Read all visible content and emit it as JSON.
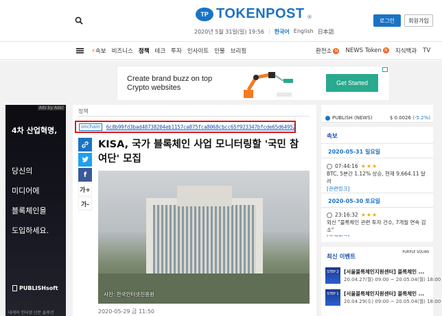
{
  "header": {
    "logo_text": "TOKENPOST",
    "logo_mark": "TP",
    "date": "2020년 5월 31일(일) 19:56",
    "langs": [
      "한국어",
      "English",
      "日本語"
    ],
    "login": "로그인",
    "join": "회원가입"
  },
  "nav": {
    "left": [
      "속보",
      "비즈니스",
      "정책",
      "테크",
      "투자",
      "인사이트",
      "인물",
      "브리핑"
    ],
    "right_exchange": "환전소",
    "right_news_token": "NEWS Token",
    "right_dict": "지식백과",
    "right_tv": "TV",
    "badge": "N"
  },
  "banner": {
    "line1": "Create brand buzz on top",
    "line2": "Crypto websites",
    "cta": "Get Started"
  },
  "leftad": {
    "adsby": "Ads by Adel",
    "headline": "4차 산업혁명,",
    "lines": [
      "당신의",
      "미디어에",
      "블록체인을",
      "도입하세요."
    ],
    "brand": "PUBLISHsoft",
    "footer": "대세의 인터넷 신문 솔루션"
  },
  "article": {
    "category": "정책",
    "onchain_tag": "onchain",
    "hash": "6c8b99fd3bad48738204eb1157ca875fca8068cbcc65f923347bfcde65d64952",
    "title": "KISA, 국가 블록체인 사업 모니터링할 '국민 참여단' 모집",
    "photo_caption": "사진: 한국인터넷진흥원",
    "date": "2020-05-29 금 11:50",
    "share_font_up": "가+",
    "share_font_down": "가-"
  },
  "ticker": {
    "name": "PUBLISH (NEWS)",
    "value": "$ 0.0026",
    "change": "(-5.2%)"
  },
  "breaking": {
    "title": "속보",
    "days": [
      {
        "date": "2020-05-31 일요일",
        "time": "07:44:16",
        "stars": "★★★",
        "text": "BTC, 5분간 1.12% 상승, 현재 9,664.11 달러",
        "link": "[관련링크]"
      },
      {
        "date": "2020-05-30 토요일",
        "time": "23:16:32",
        "stars": "★★★",
        "text": "외신 \"블록체인 관련 투자 건수, 7개월 연속 감소\"",
        "link": "[관련링크]"
      }
    ]
  },
  "events": {
    "title": "최신 이벤트",
    "logo": "PURPLE SQUAN",
    "items": [
      {
        "thumb": "STEP 2",
        "title": "[서울블록체인지원센터] 블록체인 ...",
        "date": "20.04.27(월) 09:00 ~ 20.05.04(월) 18:00"
      },
      {
        "thumb": "STEP 1",
        "title": "[서울블록체인지원센터] 블록체인 ...",
        "date": "20.04.29(수) 09:00 ~ 20.05.04(월) 18:00"
      }
    ]
  },
  "colors": {
    "brand": "#1a73c4",
    "highlight_border": "#e01616",
    "cta": "#29a98e",
    "star": "#f0a818"
  }
}
